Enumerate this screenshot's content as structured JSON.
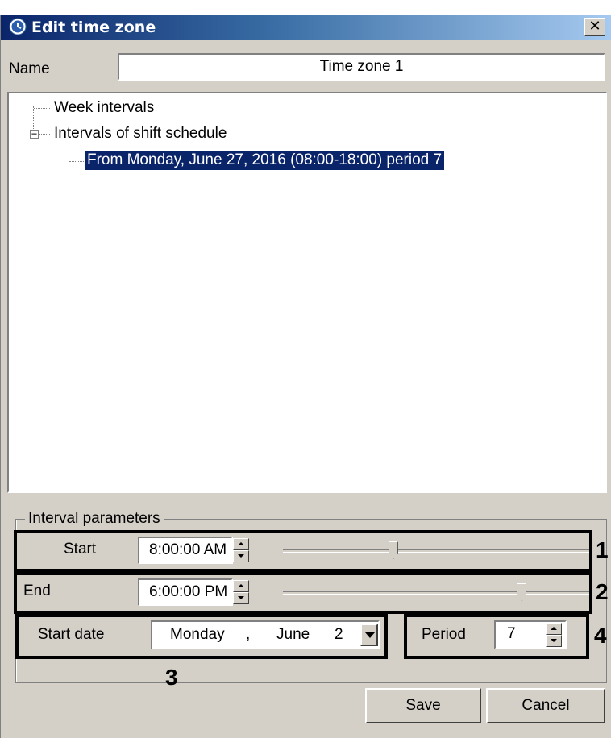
{
  "window": {
    "title": "Edit time zone",
    "close_glyph": "✕"
  },
  "name_field": {
    "label": "Name",
    "value": "Time zone 1"
  },
  "tree": {
    "items": [
      {
        "label": "Week intervals"
      },
      {
        "label": "Intervals of shift schedule",
        "expander": "−"
      },
      {
        "label": "From Monday, June 27, 2016 (08:00-18:00) period 7",
        "selected": true
      }
    ]
  },
  "interval_parameters": {
    "group_title": "Interval parameters",
    "start": {
      "label": "Start",
      "value": "8:00:00 AM",
      "slider_fraction": 0.36
    },
    "end": {
      "label": "End",
      "value": "6:00:00 PM",
      "slider_fraction": 0.78
    },
    "start_date": {
      "label": "Start date",
      "weekday": "Monday",
      "separator": ",",
      "month": "June",
      "day_partial": "2"
    },
    "period": {
      "label": "Period",
      "value": "7"
    }
  },
  "callouts": [
    "1",
    "2",
    "3",
    "4"
  ],
  "buttons": {
    "save": "Save",
    "cancel": "Cancel"
  },
  "icons": {
    "title": "clock-icon",
    "close": "close-icon",
    "spin": "spin-up-down-icon",
    "dropdown": "dropdown-arrow-icon"
  },
  "colors": {
    "title_bar_start": "#0a246a",
    "title_bar_end": "#a6caf0",
    "selection": "#0a246a",
    "face": "#d4d0c8"
  }
}
